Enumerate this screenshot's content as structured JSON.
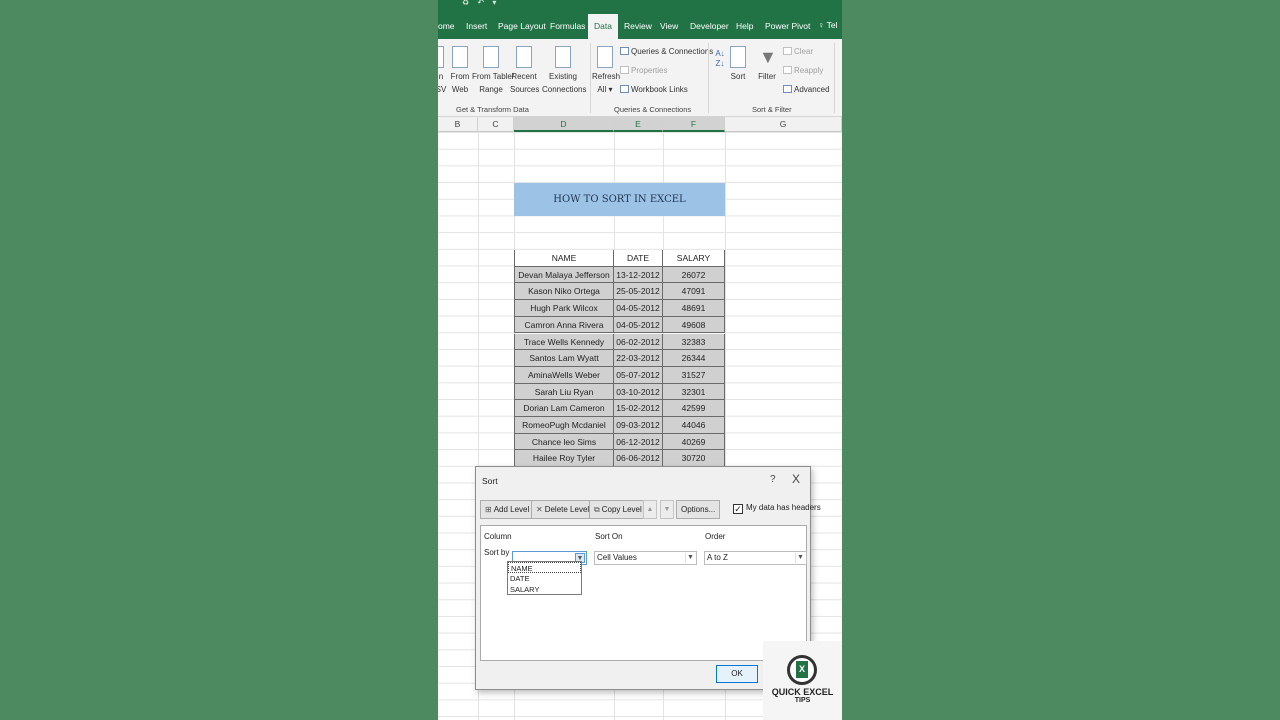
{
  "quick_access": {
    "items": [
      "♻",
      "↶",
      "▾"
    ]
  },
  "ribbon_tabs": [
    {
      "label": "ome"
    },
    {
      "label": "Insert"
    },
    {
      "label": "Page Layout"
    },
    {
      "label": "Formulas"
    },
    {
      "label": "Data",
      "active": true
    },
    {
      "label": "Review"
    },
    {
      "label": "View"
    },
    {
      "label": "Developer"
    },
    {
      "label": "Help"
    },
    {
      "label": "Power Pivot"
    }
  ],
  "tell_me": {
    "label": "Tel"
  },
  "ribbon": {
    "get_transform": {
      "from_csv_1": "n",
      "from_csv_2": "SV",
      "from_web_1": "From",
      "from_web_2": "Web",
      "from_table_1": "From Table/",
      "from_table_2": "Range",
      "recent_1": "Recent",
      "recent_2": "Sources",
      "existing_1": "Existing",
      "existing_2": "Connections",
      "group_label": "Get & Transform Data"
    },
    "queries": {
      "refresh_1": "Refresh",
      "refresh_2": "All",
      "queries_connections": "Queries & Connections",
      "properties": "Properties",
      "workbook_links": "Workbook Links",
      "group_label": "Queries & Connections"
    },
    "sort_filter": {
      "sort": "Sort",
      "filter": "Filter",
      "clear": "Clear",
      "reapply": "Reapply",
      "advanced": "Advanced",
      "group_label": "Sort & Filter"
    }
  },
  "columns": [
    "B",
    "C",
    "D",
    "E",
    "F",
    "G"
  ],
  "sheet": {
    "title": "HOW TO SORT IN EXCEL",
    "headers": [
      "NAME",
      "DATE",
      "SALARY"
    ],
    "rows": [
      {
        "name": "Devan Malaya Jefferson",
        "date": "13-12-2012",
        "salary": "26072"
      },
      {
        "name": "Kason Niko Ortega",
        "date": "25-05-2012",
        "salary": "47091"
      },
      {
        "name": "Hugh Park Wilcox",
        "date": "04-05-2012",
        "salary": "48691"
      },
      {
        "name": "Camron Anna Rivera",
        "date": "04-05-2012",
        "salary": "49608"
      },
      {
        "name": "Trace Wells Kennedy",
        "date": "06-02-2012",
        "salary": "32383"
      },
      {
        "name": "Santos Lam Wyatt",
        "date": "22-03-2012",
        "salary": "26344"
      },
      {
        "name": "AminaWells  Weber",
        "date": "05-07-2012",
        "salary": "31527"
      },
      {
        "name": "Sarah Liu Ryan",
        "date": "03-10-2012",
        "salary": "32301"
      },
      {
        "name": "Dorian Lam Cameron",
        "date": "15-02-2012",
        "salary": "42599"
      },
      {
        "name": "RomeoPugh  Mcdaniel",
        "date": "09-03-2012",
        "salary": "44046"
      },
      {
        "name": "Chance  leo Sims",
        "date": "06-12-2012",
        "salary": "40269"
      },
      {
        "name": "Hailee Roy Tyler",
        "date": "06-06-2012",
        "salary": "30720"
      }
    ]
  },
  "sort_dialog": {
    "title": "Sort",
    "help": "?",
    "close": "X",
    "add_level": "Add Level",
    "delete_level": "Delete Level",
    "copy_level": "Copy Level",
    "options": "Options...",
    "my_data_has_headers": "My data has headers",
    "headers_checked": "✓",
    "column_label": "Column",
    "sort_on_label": "Sort On",
    "order_label": "Order",
    "sort_by_label": "Sort by",
    "sort_by_value": "",
    "sort_on_value": "Cell Values",
    "order_value": "A to Z",
    "dropdown_options": [
      "NAME",
      "DATE",
      "SALARY"
    ],
    "ok": "OK"
  },
  "logo": {
    "line1": "QUICK EXCEL",
    "line2": "TIPS",
    "glyph": "X"
  },
  "colors": {
    "excel_green": "#217346",
    "title_fill": "#9cc2e5",
    "selection_gray": "#d0d0d0"
  }
}
